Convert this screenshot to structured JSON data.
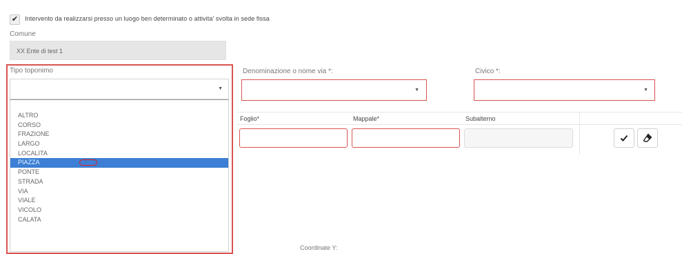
{
  "checkbox": {
    "checked_glyph": "✔",
    "label": "Intervento da realizzarsi presso un luogo ben determinato o attivita' svolta in sede fissa"
  },
  "comune": {
    "label": "Comune",
    "value": "XX Ente di test 1"
  },
  "toponimo": {
    "label": "Tipo toponimo",
    "caret": "▼",
    "options": [
      "ALTRO",
      "CORSO",
      "FRAZIONE",
      "LARGO",
      "LOCALITA",
      "PIAZZA",
      "PONTE",
      "STRADA",
      "VIA",
      "VIALE",
      "VICOLO",
      "CALATA"
    ],
    "selected": "PIAZZA"
  },
  "denominazione": {
    "label": "Denominazione o nome via *:",
    "caret": "▼"
  },
  "civico": {
    "label": "Civico *:",
    "caret": "▼"
  },
  "catasto": {
    "headers": [
      "Foglio*",
      "Mappale*",
      "Subalterno"
    ]
  },
  "actions": {
    "confirm_icon": "check-icon",
    "erase_icon": "eraser-icon"
  },
  "coordinate": {
    "label": "Coordinate Y:"
  },
  "colors": {
    "accent_red": "#d9534f",
    "selected_blue": "#3c7fd4"
  }
}
